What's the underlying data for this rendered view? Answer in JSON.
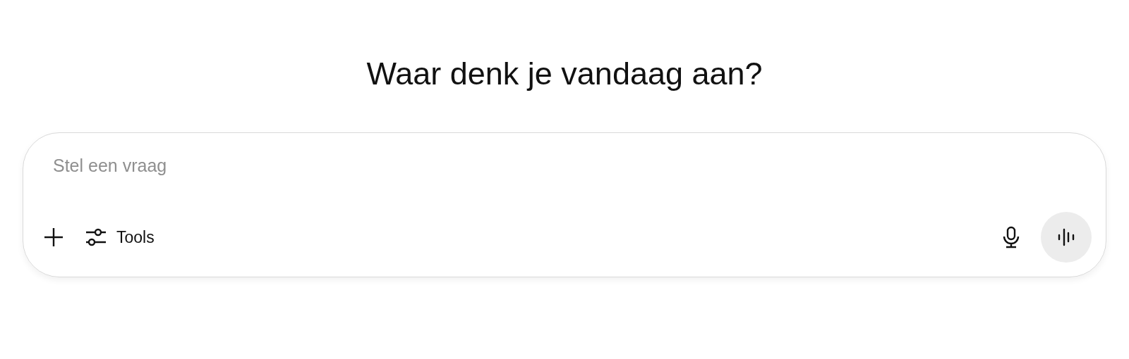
{
  "heading": "Waar denk je vandaag aan?",
  "composer": {
    "placeholder": "Stel een vraag",
    "tools_label": "Tools"
  }
}
